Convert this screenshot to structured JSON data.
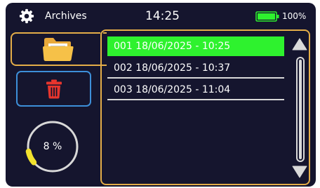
{
  "status_bar": {
    "title": "Archives",
    "time": "14:25",
    "battery_percent": "100%",
    "battery_level": 1.0,
    "battery_color": "#2ef22e"
  },
  "sidebar": {
    "folder_button_icon": "folder-icon",
    "delete_button_icon": "trash-icon",
    "storage_label": "8 %",
    "storage_fraction": 0.08,
    "storage_color": "#f2e22e"
  },
  "archives": {
    "items": [
      {
        "label": "001 18/06/2025 - 10:25",
        "selected": true
      },
      {
        "label": "002 18/06/2025 - 10:37",
        "selected": false
      },
      {
        "label": "003 18/06/2025 - 11:04",
        "selected": false
      }
    ],
    "selected_color": "#2ef22e"
  },
  "colors": {
    "background": "#15152e",
    "accent_orange": "#e4ad48",
    "accent_blue": "#3d8fd9",
    "danger_red": "#e8352d"
  }
}
